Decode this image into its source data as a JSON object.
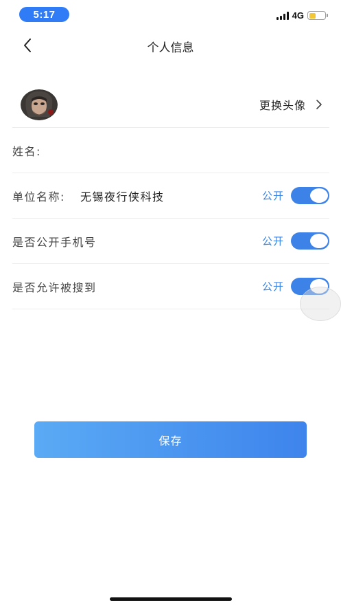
{
  "status_bar": {
    "time": "5:17",
    "network": "4G",
    "battery_level": 0.45,
    "battery_color": "#f2c634",
    "time_pill_color": "#2f7cf6"
  },
  "nav": {
    "back_icon": "chevron-left-icon",
    "title": "个人信息"
  },
  "avatar_row": {
    "change_label": "更换头像",
    "chevron_icon": "chevron-right-icon"
  },
  "rows": {
    "name": {
      "label": "姓名:",
      "value": ""
    },
    "company": {
      "label": "单位名称:",
      "value": "无锡夜行侠科技",
      "public_label": "公开",
      "toggle_on": true
    },
    "phone_public": {
      "label": "是否公开手机号",
      "public_label": "公开",
      "toggle_on": true
    },
    "searchable": {
      "label": "是否允许被搜到",
      "public_label": "公开",
      "toggle_on": true
    }
  },
  "save_button": {
    "label": "保存"
  },
  "colors": {
    "accent": "#3d82e6",
    "button_gradient_start": "#5aaaf5",
    "button_gradient_end": "#3e84ec"
  }
}
